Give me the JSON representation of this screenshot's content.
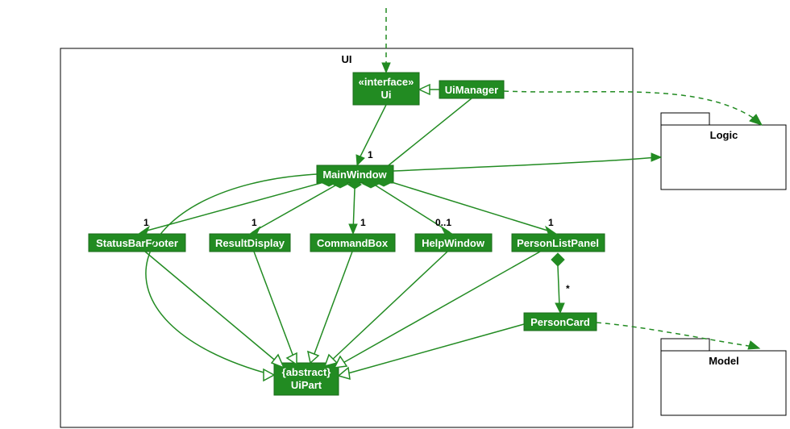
{
  "package": {
    "title": "UI"
  },
  "nodes": {
    "ui": {
      "stereotype": "«interface»",
      "name": "Ui"
    },
    "uiManager": {
      "name": "UiManager"
    },
    "mainWindow": {
      "name": "MainWindow"
    },
    "statusBar": {
      "name": "StatusBarFooter"
    },
    "resultDisp": {
      "name": "ResultDisplay"
    },
    "cmdBox": {
      "name": "CommandBox"
    },
    "helpWin": {
      "name": "HelpWindow"
    },
    "plPanel": {
      "name": "PersonListPanel"
    },
    "personCard": {
      "name": "PersonCard"
    },
    "uiPart": {
      "stereotype": "{abstract}",
      "name": "UiPart"
    }
  },
  "external": {
    "logic": {
      "name": "Logic"
    },
    "model": {
      "name": "Model"
    }
  },
  "mult": {
    "uiToMain": "1",
    "mainToStatus": "1",
    "mainToResult": "1",
    "mainToCmd": "1",
    "mainToHelp": "0..1",
    "mainToPlp": "1",
    "plpToCard": "*"
  },
  "colors": {
    "node": "#228B22",
    "edge": "#228B22"
  }
}
